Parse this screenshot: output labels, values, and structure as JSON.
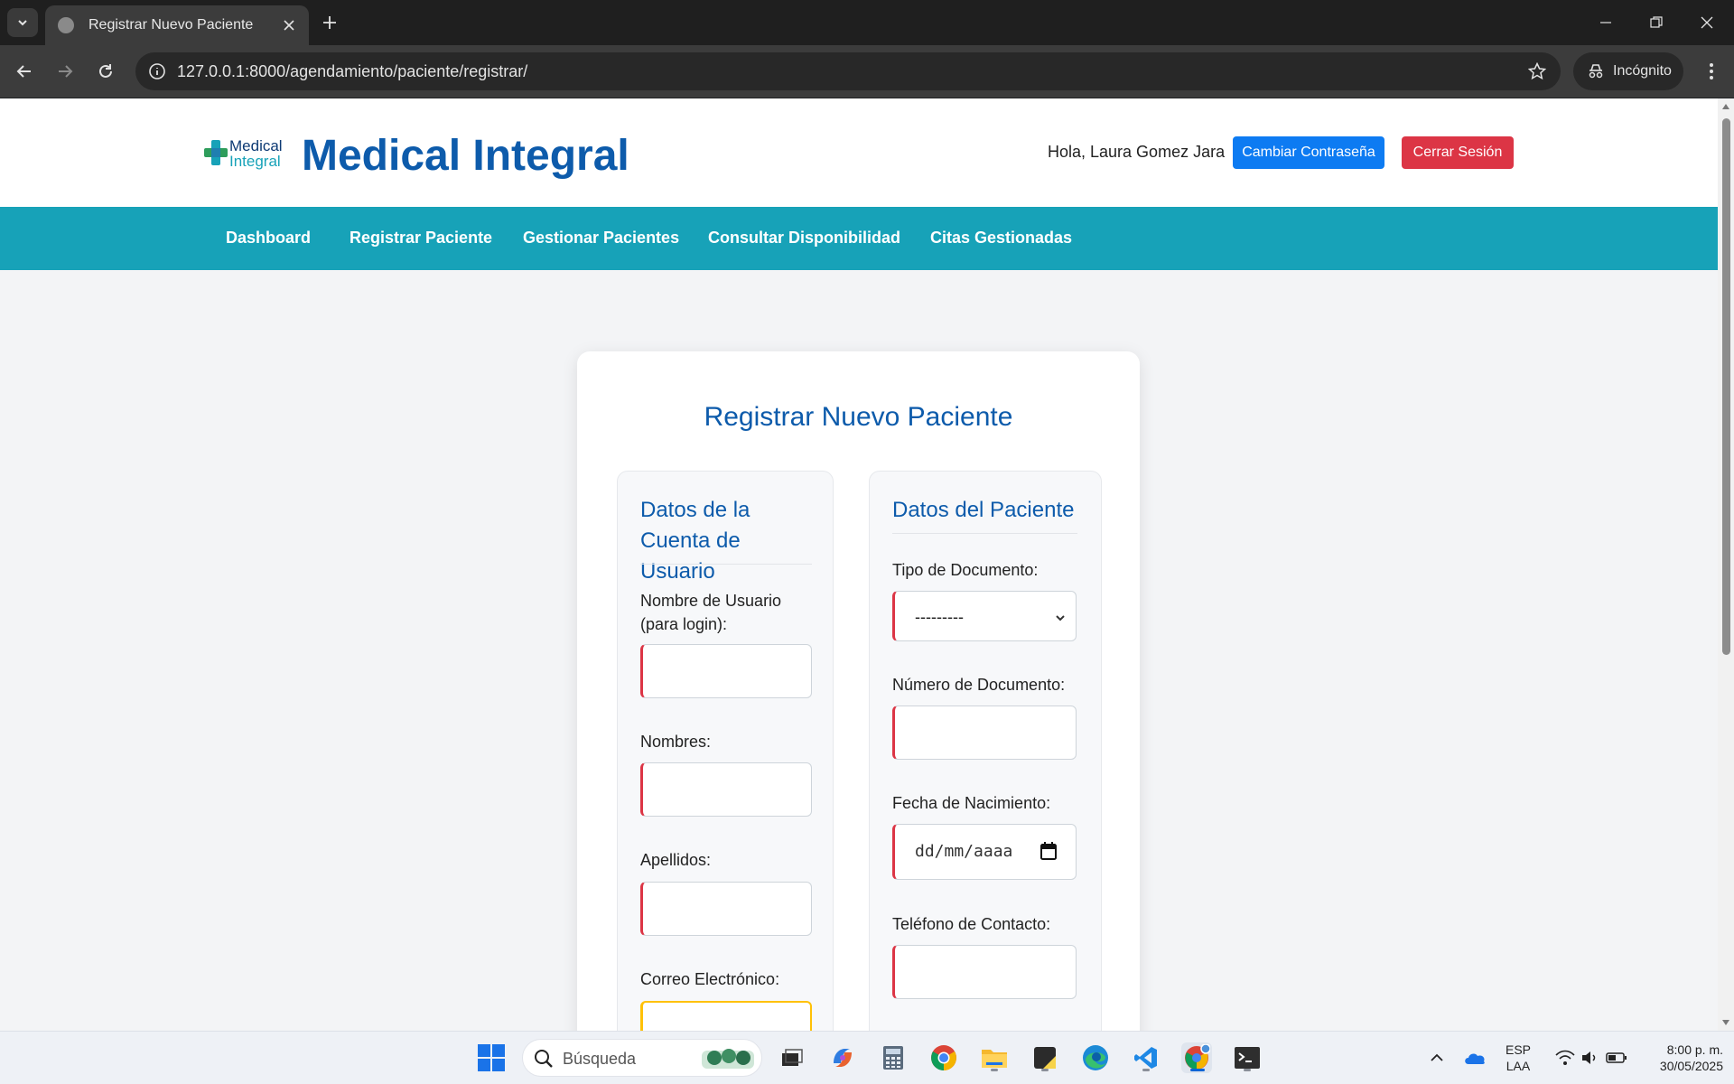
{
  "browser": {
    "tab_title": "Registrar Nuevo Paciente",
    "url": "127.0.0.1:8000/agendamiento/paciente/registrar/",
    "profile_label": "Incógnito"
  },
  "site": {
    "logo_line1": "Medical",
    "logo_line2": "Integral",
    "title": "Medical Integral",
    "greeting": "Hola, Laura Gomez Jara",
    "change_password_label": "Cambiar Contraseña",
    "logout_label": "Cerrar Sesión",
    "colors": {
      "primary": "#0d5bab",
      "nav": "#17a2b8",
      "button_blue": "#0d7bf2",
      "button_red": "#dc3545"
    }
  },
  "nav": {
    "items": [
      {
        "label": "Dashboard"
      },
      {
        "label": "Registrar Paciente"
      },
      {
        "label": "Gestionar Pacientes"
      },
      {
        "label": "Consultar Disponibilidad"
      },
      {
        "label": "Citas Gestionadas"
      }
    ]
  },
  "form": {
    "title": "Registrar Nuevo Paciente",
    "account_section": {
      "heading": "Datos de la Cuenta de Usuario",
      "username_label": "Nombre de Usuario (para login):",
      "names_label": "Nombres:",
      "surnames_label": "Apellidos:",
      "email_label": "Correo Electrónico:"
    },
    "patient_section": {
      "heading": "Datos del Paciente",
      "doc_type_label": "Tipo de Documento:",
      "doc_type_value": "---------",
      "doc_number_label": "Número de Documento:",
      "birth_date_label": "Fecha de Nacimiento:",
      "birth_date_placeholder": "dd/mm/aaaa",
      "phone_label": "Teléfono de Contacto:"
    }
  },
  "taskbar": {
    "search_placeholder": "Búsqueda",
    "lang_line1": "ESP",
    "lang_line2": "LAA",
    "time": "8:00 p. m.",
    "date": "30/05/2025"
  }
}
